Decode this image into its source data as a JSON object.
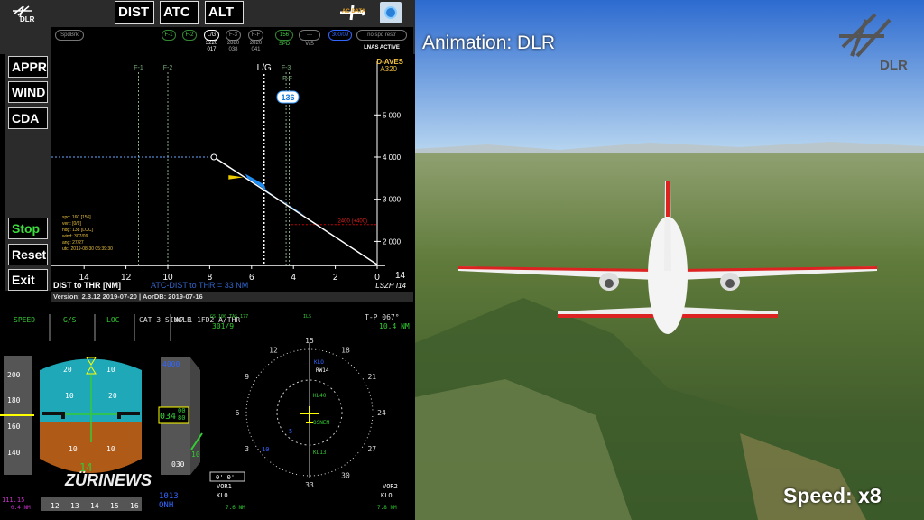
{
  "toolbar": {
    "buttons": [
      "DIST",
      "ATC",
      "ALT"
    ],
    "ac_data_label": "AC DATA",
    "logo": "DLR"
  },
  "status_row": {
    "spdbrk": "SpdBrk",
    "configs": [
      {
        "label": "F-1",
        "val1": "",
        "val2": ""
      },
      {
        "label": "F-2",
        "val1": "",
        "val2": ""
      },
      {
        "label": "L/G",
        "val1": "3220",
        "val2": "017"
      },
      {
        "label": "F-3",
        "val1": "2880",
        "val2": "038"
      },
      {
        "label": "F-F",
        "val1": "2820",
        "val2": "041"
      }
    ],
    "spd_value": "156",
    "spd_label": "SPD",
    "vs_value": "---",
    "vs_label": "V/S",
    "alt_constraint": "300/09",
    "spd_restr": "no spd restr",
    "lnas": "LNAS ACTIVE"
  },
  "sidebar": {
    "top": [
      "APPR",
      "WIND",
      "CDA"
    ],
    "bottom": [
      "Stop",
      "Reset",
      "Exit"
    ],
    "stop_color": "#3ddc3d"
  },
  "chart_data": {
    "type": "line",
    "aircraft": "D-AVES",
    "aircraft_type": "A320",
    "xlabel": "DIST to THR [NM]",
    "atc_dist": "ATC-DIST to THR = 33 NM",
    "runway": "LSZH I14",
    "x_right_label": "14",
    "xlim": [
      14,
      0
    ],
    "ylim": [
      1400,
      6000
    ],
    "x_ticks": [
      14,
      12,
      10,
      8,
      6,
      4,
      2,
      0
    ],
    "y_ticks": [
      5000,
      4000,
      3000,
      2000
    ],
    "y_tick_labels": [
      "5 000",
      "4 000",
      "3 000",
      "2 000"
    ],
    "markers": [
      {
        "label": "F-1",
        "x": 11.4
      },
      {
        "label": "F-2",
        "x": 10.0
      },
      {
        "label": "L/G",
        "x": 5.4
      },
      {
        "label": "F-3",
        "x": 4.35
      },
      {
        "label": "F-F",
        "x": 4.2
      }
    ],
    "speed_bubble": "136",
    "profile": {
      "x": [
        7.8,
        0
      ],
      "y": [
        4000,
        1450
      ]
    },
    "constraint_label": "2400 (+400)",
    "constraint_alt": 2400,
    "info": [
      "spd: 160 [156]",
      "vert: [0/9]",
      "hdg: 138 [LOC]",
      "wind: 307/09",
      "ang: 27/27",
      "utc: 2019-08-30 05:39:30"
    ]
  },
  "version": "Version: 2.3.12 2019-07-20 | AorDB: 2019-07-16",
  "pfd": {
    "fma": [
      "SPEED",
      "G/S",
      "LOC",
      "CAT 3\nSINGLE",
      "AP 1\n1FD2\nA/THR"
    ],
    "speeds": [
      "200",
      "180",
      "160",
      "140"
    ],
    "pitch": [
      "20",
      "10",
      "10",
      "20",
      "10",
      "10"
    ],
    "alt_sel": "4000",
    "alt_big": "034",
    "alt_small": "00\n80",
    "alt_low": "030",
    "vs": "10",
    "baro": "1013",
    "baro_label": "QNH",
    "ils_freq": "111.15",
    "ils_dme": "0.4 NM",
    "heading": [
      "12",
      "13",
      "14",
      "15",
      "16"
    ],
    "gs_tas": "GS 100  TAS 177",
    "wind": "301/9",
    "ils_label": "ILS",
    "tp": "T-P 067°",
    "tp_dist": "10.4 NM",
    "compass": [
      "12",
      "15",
      "18",
      "21",
      "24",
      "27",
      "30",
      "33",
      "3",
      "6",
      "9"
    ],
    "waypoints": [
      "KLO",
      "RW14",
      "KL40",
      "OSNEM",
      "KL13"
    ],
    "chrono": "0' 0'",
    "vor1": "VOR1",
    "vor1_id": "KLO",
    "vor1_dist": "7.6 NM",
    "vor2": "VOR2",
    "vor2_id": "KLO",
    "vor2_dist": "7.8 NM",
    "ranges": [
      "5",
      "10"
    ]
  },
  "watermark": "ZÜRINEWS",
  "view": {
    "title": "Animation: DLR",
    "logo": "DLR",
    "speed": "Speed: x8"
  }
}
